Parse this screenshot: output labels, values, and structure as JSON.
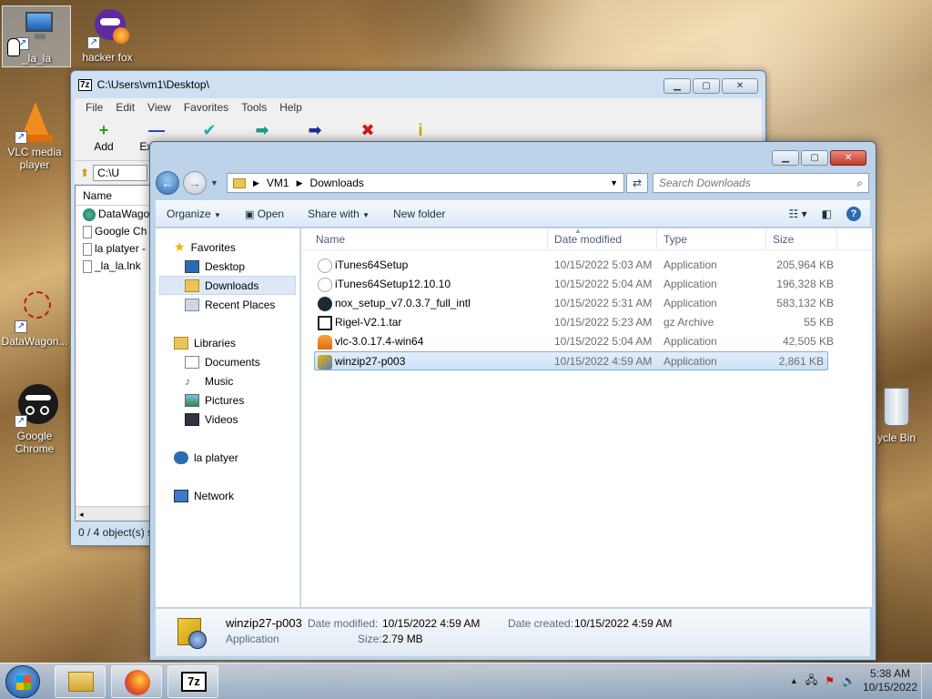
{
  "desktop": {
    "icons": [
      {
        "label": "_la_la",
        "icon": "monitor-shortcut-icon"
      },
      {
        "label": "hacker fox",
        "icon": "firefox-mask-icon"
      },
      {
        "label": "VLC media player",
        "icon": "vlc-cone-icon"
      },
      {
        "label": "DataWagon...",
        "icon": "datawagon-icon"
      },
      {
        "label": "Google Chrome",
        "icon": "incognito-icon"
      },
      {
        "label": "ycle Bin",
        "icon": "recycle-bin-icon"
      }
    ]
  },
  "sevenzip": {
    "title": "C:\\Users\\vm1\\Desktop\\",
    "app_icon": "7z",
    "menu": [
      "File",
      "Edit",
      "View",
      "Favorites",
      "Tools",
      "Help"
    ],
    "toolbar": [
      {
        "label": "Add",
        "icon": "+",
        "color": "#1fa51f"
      },
      {
        "label": "Extract",
        "icon": "—",
        "color": "#1d3fbf"
      },
      {
        "label": "",
        "icon": "✔",
        "color": "#1fb3b3"
      },
      {
        "label": "",
        "icon": "➡",
        "color": "#1f9a8a"
      },
      {
        "label": "",
        "icon": "➡",
        "color": "#1d2d9a"
      },
      {
        "label": "",
        "icon": "✖",
        "color": "#d01818"
      },
      {
        "label": "",
        "icon": "i",
        "color": "#c8a400"
      }
    ],
    "address": "C:\\U",
    "list_header": "Name",
    "files": [
      "DataWago",
      "Google Ch",
      "la platyer -",
      "_la_la.lnk"
    ],
    "status": "0 / 4 object(s) s"
  },
  "explorer": {
    "breadcrumb": [
      "VM1",
      "Downloads"
    ],
    "search_placeholder": "Search Downloads",
    "commands": [
      "Organize",
      "Open",
      "Share with",
      "New folder"
    ],
    "nav": {
      "favorites": "Favorites",
      "favorites_items": [
        "Desktop",
        "Downloads",
        "Recent Places"
      ],
      "libraries": "Libraries",
      "libraries_items": [
        "Documents",
        "Music",
        "Pictures",
        "Videos"
      ],
      "homegroup": "la platyer",
      "network": "Network"
    },
    "columns": [
      "Name",
      "Date modified",
      "Type",
      "Size"
    ],
    "files": [
      {
        "name": "iTunes64Setup",
        "date": "10/15/2022 5:03 AM",
        "type": "Application",
        "size": "205,964 KB",
        "icon": "itunes-icon"
      },
      {
        "name": "iTunes64Setup12.10.10",
        "date": "10/15/2022 5:04 AM",
        "type": "Application",
        "size": "196,328 KB",
        "icon": "itunes-icon"
      },
      {
        "name": "nox_setup_v7.0.3.7_full_intl",
        "date": "10/15/2022 5:31 AM",
        "type": "Application",
        "size": "583,132 KB",
        "icon": "nox-icon"
      },
      {
        "name": "Rigel-V2.1.tar",
        "date": "10/15/2022 5:23 AM",
        "type": "gz Archive",
        "size": "55 KB",
        "icon": "archive-icon"
      },
      {
        "name": "vlc-3.0.17.4-win64",
        "date": "10/15/2022 5:04 AM",
        "type": "Application",
        "size": "42,505 KB",
        "icon": "vlc-icon"
      },
      {
        "name": "winzip27-p003",
        "date": "10/15/2022 4:59 AM",
        "type": "Application",
        "size": "2,861 KB",
        "icon": "winzip-icon"
      }
    ],
    "details": {
      "name": "winzip27-p003",
      "type": "Application",
      "date_modified_label": "Date modified:",
      "date_modified": "10/15/2022 4:59 AM",
      "date_created_label": "Date created:",
      "date_created": "10/15/2022 4:59 AM",
      "size_label": "Size:",
      "size": "2.79 MB"
    }
  },
  "taskbar": {
    "time": "5:38 AM",
    "date": "10/15/2022"
  }
}
